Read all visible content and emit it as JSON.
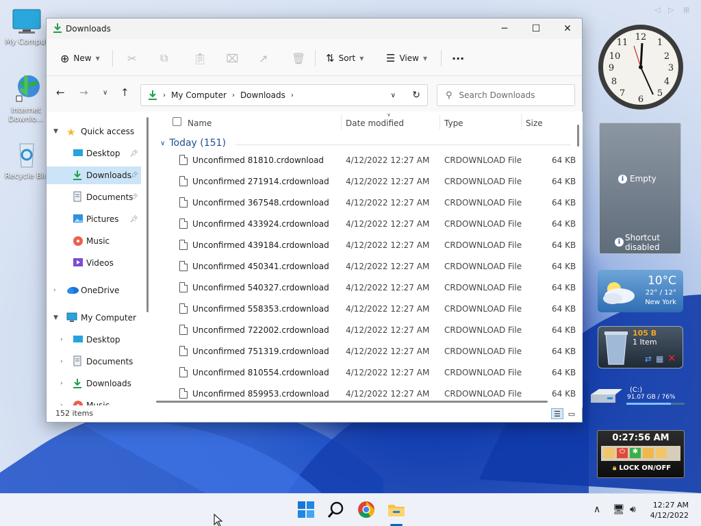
{
  "desktop": {
    "icons": [
      {
        "label": "My Comput"
      },
      {
        "label": "Internet Downlo..."
      },
      {
        "label": "Recycle Bin"
      }
    ]
  },
  "window": {
    "title": "Downloads",
    "toolbar": {
      "new": "New",
      "sort": "Sort",
      "view": "View",
      "more": "···"
    },
    "address": {
      "root": "My Computer",
      "current": "Downloads"
    },
    "search": {
      "placeholder": "Search Downloads"
    },
    "nav": {
      "quick_access": "Quick access",
      "desktop": "Desktop",
      "downloads": "Downloads",
      "documents": "Documents",
      "pictures": "Pictures",
      "music": "Music",
      "videos": "Videos",
      "onedrive": "OneDrive",
      "my_computer": "My Computer",
      "mc_desktop": "Desktop",
      "mc_documents": "Documents",
      "mc_downloads": "Downloads",
      "mc_music": "Music"
    },
    "columns": {
      "name": "Name",
      "date": "Date modified",
      "type": "Type",
      "size": "Size"
    },
    "group": "Today (151)",
    "files": [
      {
        "name": "Unconfirmed 81810.crdownload",
        "date": "4/12/2022 12:27 AM",
        "type": "CRDOWNLOAD File",
        "size": "64 KB"
      },
      {
        "name": "Unconfirmed 271914.crdownload",
        "date": "4/12/2022 12:27 AM",
        "type": "CRDOWNLOAD File",
        "size": "64 KB"
      },
      {
        "name": "Unconfirmed 367548.crdownload",
        "date": "4/12/2022 12:27 AM",
        "type": "CRDOWNLOAD File",
        "size": "64 KB"
      },
      {
        "name": "Unconfirmed 433924.crdownload",
        "date": "4/12/2022 12:27 AM",
        "type": "CRDOWNLOAD File",
        "size": "64 KB"
      },
      {
        "name": "Unconfirmed 439184.crdownload",
        "date": "4/12/2022 12:27 AM",
        "type": "CRDOWNLOAD File",
        "size": "64 KB"
      },
      {
        "name": "Unconfirmed 450341.crdownload",
        "date": "4/12/2022 12:27 AM",
        "type": "CRDOWNLOAD File",
        "size": "64 KB"
      },
      {
        "name": "Unconfirmed 540327.crdownload",
        "date": "4/12/2022 12:27 AM",
        "type": "CRDOWNLOAD File",
        "size": "64 KB"
      },
      {
        "name": "Unconfirmed 558353.crdownload",
        "date": "4/12/2022 12:27 AM",
        "type": "CRDOWNLOAD File",
        "size": "64 KB"
      },
      {
        "name": "Unconfirmed 722002.crdownload",
        "date": "4/12/2022 12:27 AM",
        "type": "CRDOWNLOAD File",
        "size": "64 KB"
      },
      {
        "name": "Unconfirmed 751319.crdownload",
        "date": "4/12/2022 12:27 AM",
        "type": "CRDOWNLOAD File",
        "size": "64 KB"
      },
      {
        "name": "Unconfirmed 810554.crdownload",
        "date": "4/12/2022 12:27 AM",
        "type": "CRDOWNLOAD File",
        "size": "64 KB"
      },
      {
        "name": "Unconfirmed 859953.crdownload",
        "date": "4/12/2022 12:27 AM",
        "type": "CRDOWNLOAD File",
        "size": "64 KB"
      }
    ],
    "status": "152 items"
  },
  "gadgets": {
    "notes": {
      "line1": "Empty",
      "line2": "Shortcut",
      "line3": "disabled"
    },
    "weather": {
      "temp": "10°C",
      "range": "22° / 12°",
      "city": "New York"
    },
    "recycle": {
      "size": "105 B",
      "items": "1 Item"
    },
    "drive": {
      "label": "(C:)",
      "info": "91.07 GB / 76%"
    },
    "lock": {
      "time": "0:27:56 AM",
      "label": "LOCK ON/OFF"
    }
  },
  "taskbar": {
    "time": "12:27 AM",
    "date": "4/12/2022"
  },
  "colors": {
    "accent": "#0067c0",
    "selection": "#cce4f7",
    "download_green": "#1e9e4a"
  }
}
